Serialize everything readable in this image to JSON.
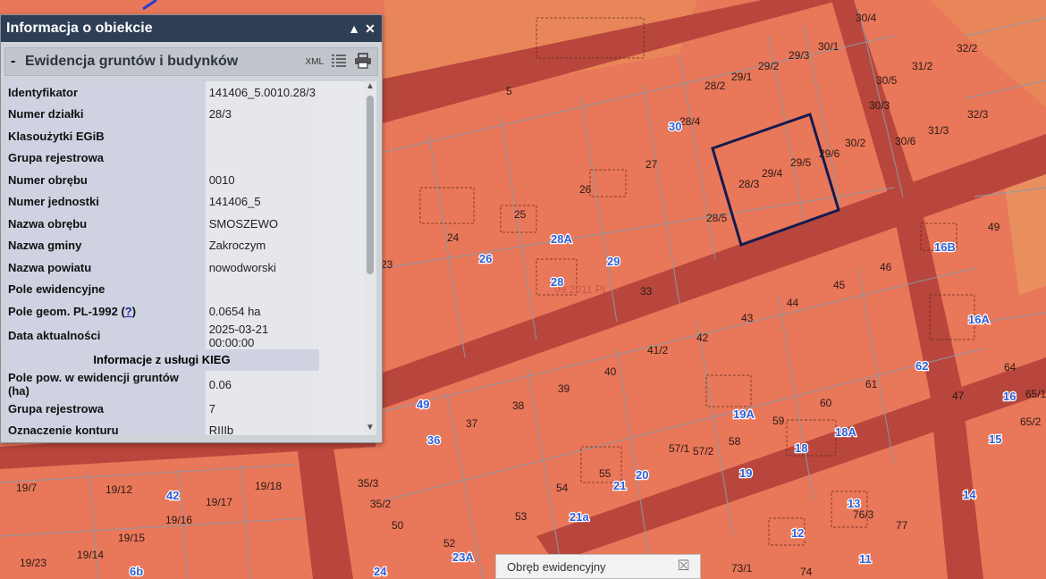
{
  "popup": {
    "title": "Informacja o obiekcie",
    "minimize_glyph": "▲",
    "close_glyph": "✕",
    "section": {
      "collapse_glyph": "-",
      "title": "Ewidencja gruntów i budynków",
      "xml_label": "XML"
    },
    "rows": [
      {
        "key": "Identyfikator",
        "value": "141406_5.0010.28/3"
      },
      {
        "key": "Numer działki",
        "value": "28/3"
      },
      {
        "key": "Klasoużytki EGiB",
        "value": ""
      },
      {
        "key": "Grupa rejestrowa",
        "value": ""
      },
      {
        "key": "Numer obrębu",
        "value": "0010"
      },
      {
        "key": "Numer jednostki",
        "value": "141406_5"
      },
      {
        "key": "Nazwa obrębu",
        "value": "SMOSZEWO"
      },
      {
        "key": "Nazwa gminy",
        "value": "Zakroczym"
      },
      {
        "key": "Nazwa powiatu",
        "value": "nowodworski"
      },
      {
        "key": "Pole ewidencyjne",
        "value": ""
      },
      {
        "key": "Pole geom. PL-1992",
        "help": "?",
        "value": "0.0654 ha"
      },
      {
        "key": "Data aktualności",
        "value": "2025-03-21 00:00:00"
      }
    ],
    "group_title": "Informacje z usługi KIEG",
    "rows2": [
      {
        "key": "Pole pow. w ewidencji gruntów (ha)",
        "value": "0.06"
      },
      {
        "key": "Grupa rejestrowa",
        "value": "7"
      },
      {
        "key": "Oznaczenie konturu",
        "value": "RIIIb"
      }
    ]
  },
  "tooltip": {
    "label": "Obręb ewidencyjny",
    "close_glyph": "⮽"
  },
  "map": {
    "parcel_labels": [
      "5",
      "28/2",
      "29/1",
      "29/2",
      "29/3",
      "30/1",
      "30/4",
      "32/2",
      "31/2",
      "30/5",
      "30/3",
      "32/3",
      "31/3",
      "30/6",
      "28/4",
      "30/2",
      "29/6",
      "27",
      "26",
      "25",
      "24",
      "28/3",
      "29/4",
      "29/5",
      "28/5",
      "49",
      "23",
      "33",
      "46",
      "45",
      "44",
      "43",
      "42",
      "41/2",
      "40",
      "39",
      "38",
      "37",
      "61",
      "64",
      "65/1",
      "65/2",
      "47",
      "58",
      "57/1",
      "57/2",
      "59",
      "60",
      "54",
      "55",
      "53",
      "52",
      "50",
      "35/3",
      "35/2",
      "19/7",
      "19/12",
      "19/15",
      "19/16",
      "19/17",
      "19/18",
      "19/23",
      "19/14",
      "76/3",
      "77",
      "73/1",
      "74"
    ],
    "building_labels": [
      "30",
      "26",
      "28A",
      "29",
      "28",
      "16B",
      "16A",
      "62",
      "49",
      "36",
      "19A",
      "18",
      "18A",
      "19",
      "21",
      "20",
      "21a",
      "13",
      "12",
      "14",
      "15",
      "16",
      "42",
      "6b",
      "23A",
      "24",
      "11"
    ],
    "watermark": "09.2011 PL"
  },
  "colors": {
    "map_fill": "#e9775a",
    "road": "#b8463c",
    "header": "#2e3f55",
    "selection": "#141a4f"
  }
}
